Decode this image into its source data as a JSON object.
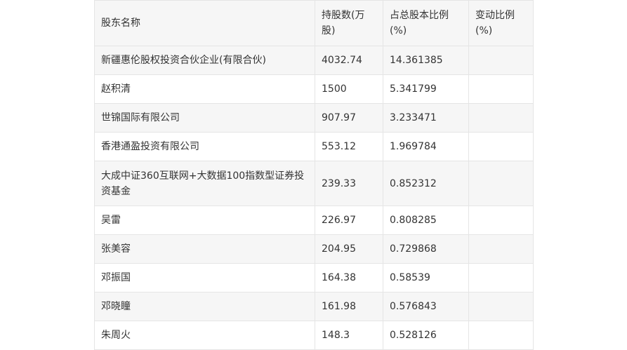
{
  "table": {
    "headers": [
      "股东名称",
      "持股数(万股)",
      "占总股本比例(%)",
      "变动比例(%)"
    ],
    "rows": [
      {
        "name": "新疆惠伦股权投资合伙企业(有限合伙)",
        "shares": "4032.74",
        "ratio": "14.361385",
        "change": ""
      },
      {
        "name": "赵积清",
        "shares": "1500",
        "ratio": "5.341799",
        "change": ""
      },
      {
        "name": "世锦国际有限公司",
        "shares": "907.97",
        "ratio": "3.233471",
        "change": ""
      },
      {
        "name": "香港通盈投资有限公司",
        "shares": "553.12",
        "ratio": "1.969784",
        "change": ""
      },
      {
        "name": "大成中证360互联网+大数据100指数型证券投资基金",
        "shares": "239.33",
        "ratio": "0.852312",
        "change": ""
      },
      {
        "name": "吴雷",
        "shares": "226.97",
        "ratio": "0.808285",
        "change": ""
      },
      {
        "name": "张美容",
        "shares": "204.95",
        "ratio": "0.729868",
        "change": ""
      },
      {
        "name": "邓振国",
        "shares": "164.38",
        "ratio": "0.58539",
        "change": ""
      },
      {
        "name": "邓晓瞳",
        "shares": "161.98",
        "ratio": "0.576843",
        "change": ""
      },
      {
        "name": "朱周火",
        "shares": "148.3",
        "ratio": "0.528126",
        "change": ""
      }
    ]
  }
}
